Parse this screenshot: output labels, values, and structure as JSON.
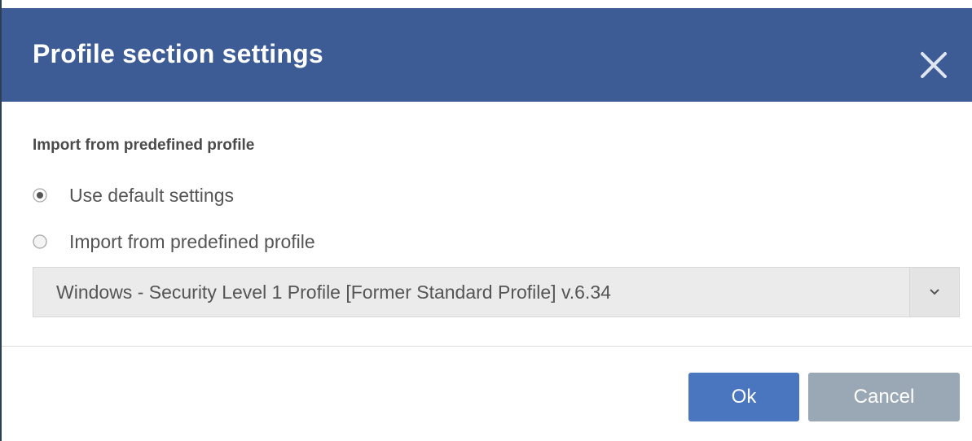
{
  "dialog": {
    "title": "Profile section settings",
    "close_icon": "close-icon"
  },
  "section": {
    "label": "Import from predefined profile"
  },
  "options": [
    {
      "label": "Use default settings",
      "selected": true
    },
    {
      "label": "Import from predefined profile",
      "selected": false
    }
  ],
  "profile_select": {
    "value": "Windows - Security Level 1 Profile [Former Standard Profile] v.6.34",
    "arrow_icon": "chevron-down-icon"
  },
  "buttons": {
    "ok_label": "Ok",
    "cancel_label": "Cancel"
  },
  "colors": {
    "header": "#3d5c95",
    "ok_button": "#4a76c0",
    "cancel_button": "#9aa8b6"
  }
}
